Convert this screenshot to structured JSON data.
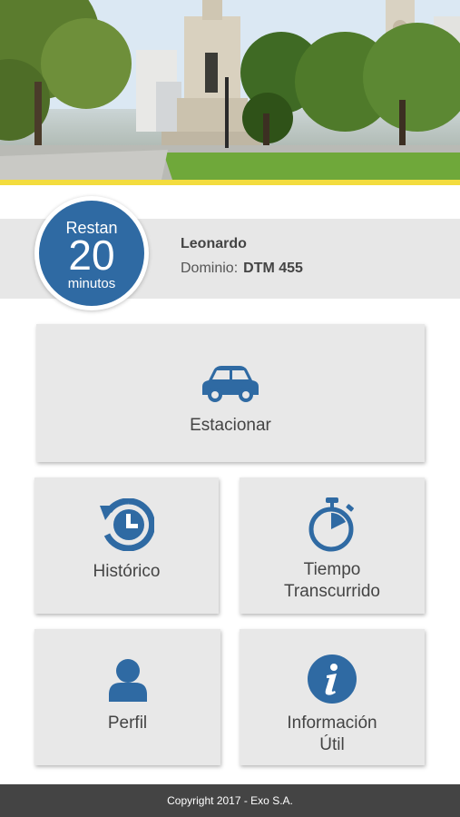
{
  "timer": {
    "top_text": "Restan",
    "value": "20",
    "bottom_text": "minutos"
  },
  "user": {
    "name": "Leonardo",
    "domain_label": "Dominio:",
    "plate": "DTM 455"
  },
  "tiles": {
    "estacionar": {
      "label": "Estacionar",
      "icon": "car-icon"
    },
    "historico": {
      "label": "Histórico",
      "icon": "history-icon"
    },
    "tiempo": {
      "label_line1": "Tiempo",
      "label_line2": "Transcurrido",
      "icon": "stopwatch-icon"
    },
    "perfil": {
      "label": "Perfil",
      "icon": "user-icon"
    },
    "info": {
      "label_line1": "Información",
      "label_line2": "Útil",
      "icon": "info-icon"
    }
  },
  "footer": {
    "text": "Copyright 2017 - Exo S.A."
  },
  "colors": {
    "accent": "#2f6aa3",
    "stripe": "#f3dc3e",
    "tile": "#e8e8e8",
    "footer": "#444444"
  }
}
